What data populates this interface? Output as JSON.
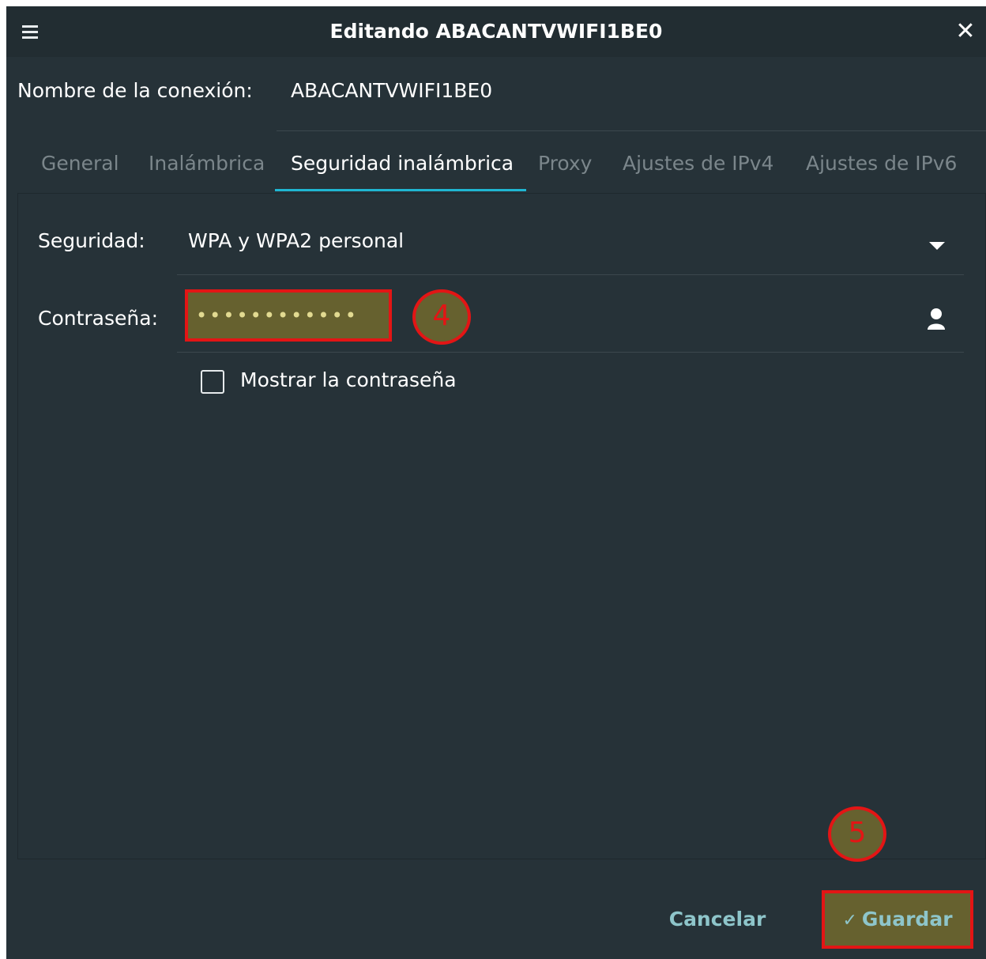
{
  "window": {
    "title": "Editando ABACANTVWIFI1BE0",
    "menu_icon": "hamburger-menu-icon",
    "close_symbol": "✕"
  },
  "connection": {
    "label": "Nombre de la conexión:",
    "value": "ABACANTVWIFI1BE0"
  },
  "tabs": [
    {
      "label": "General",
      "active": false
    },
    {
      "label": "Inalámbrica",
      "active": false
    },
    {
      "label": "Seguridad inalámbrica",
      "active": true
    },
    {
      "label": "Proxy",
      "active": false
    },
    {
      "label": "Ajustes de IPv4",
      "active": false
    },
    {
      "label": "Ajustes de IPv6",
      "active": false
    }
  ],
  "security": {
    "label": "Seguridad:",
    "value": "WPA y WPA2 personal"
  },
  "password": {
    "label": "Contraseña:",
    "value": "••••••••••••",
    "icon": "user-icon"
  },
  "show_password": {
    "label": "Mostrar la contraseña",
    "checked": false
  },
  "annotations": {
    "step_4": "4",
    "step_5": "5"
  },
  "actions": {
    "cancel_label": "Cancelar",
    "save_label": "Guardar",
    "save_check": "✓"
  },
  "colors": {
    "background": "#263238",
    "titlebar": "#222d32",
    "accent": "#1fb6d2",
    "highlight_fill": "#66612f",
    "highlight_border": "#e31515",
    "button_text": "#8ec5ca"
  }
}
